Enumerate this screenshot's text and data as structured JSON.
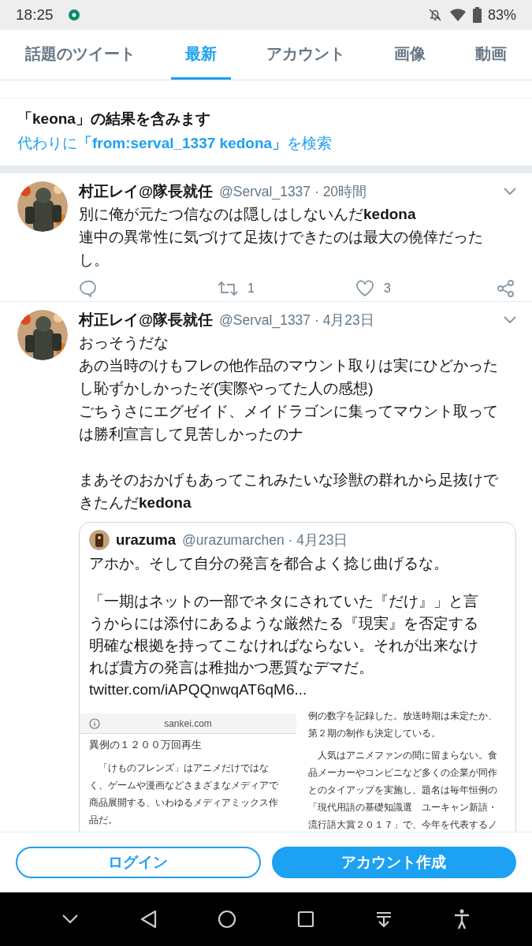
{
  "status_bar": {
    "time": "18:25",
    "battery": "83%"
  },
  "tabs": [
    {
      "label": "話題のツイート",
      "selected": false
    },
    {
      "label": "最新",
      "selected": true
    },
    {
      "label": "アカウント",
      "selected": false
    },
    {
      "label": "画像",
      "selected": false
    },
    {
      "label": "動画",
      "selected": false
    }
  ],
  "notice": {
    "title": "「keona」の結果を含みます",
    "suggestion": "代わりに**「from:serval_1337 kedona」**を検索"
  },
  "tweets": [
    {
      "name": "村正レイ@隊長就任",
      "meta": "@Serval_1337 · 20時間",
      "paragraphs": [
        [
          "別に俺が元たつ信なのは隠しはしないんだ**kedona**",
          "連中の異常性に気づけて足抜けできたのは最大の僥倖だった",
          "し。"
        ]
      ],
      "actions": {
        "retweets": "1",
        "likes": "3"
      }
    },
    {
      "name": "村正レイ@隊長就任",
      "meta": "@Serval_1337 · 4月23日",
      "paragraphs": [
        [
          "おっそうだな",
          "あの当時のけもフレの他作品のマウント取りは実にひどかった",
          "し恥ずかしかったぞ(実際やってた人の感想)",
          "ごちうさにエグゼイド、メイドラゴンに集ってマウント取って",
          "は勝利宣言して見苦しかったのナ"
        ],
        [
          "まあそのおかげもあってこれみたいな珍獣の群れから足抜けで",
          "きたんだ**kedona**"
        ]
      ],
      "quote": {
        "name": "urazuma",
        "meta": "@urazumarchen · 4月23日",
        "paragraphs": [
          [
            "アホか。そして自分の発言を都合よく捻じ曲げるな。"
          ],
          [
            "「一期はネットの一部でネタにされていた『だけ』」と言",
            "うからには添付にあるような厳然たる『現実』を否定する",
            "明確な根拠を持ってこなければならない。それが出来なけ",
            "れば貴方の発言は稚拙かつ悪質なデマだ。",
            "twitter.com/iAPQQnwqAT6qM6..."
          ]
        ],
        "media": [
          {
            "site": "sankei.com",
            "heading": "異例の１２００万回再生",
            "paragraphs": [
              [
                "　「けものフレンズ」はアニメだけではな",
                "く、ゲームや漫画などさまざまなメディアで",
                "商品展開する、いわゆるメディアミックス作",
                "品だ。"
              ]
            ]
          },
          {
            "paragraphs": [
              [
                "例の数字を記録した。放送時期は未定たか、",
                "第２期の制作も決定している。"
              ],
              [
                "　人気はアニメファンの間に留まらない。食",
                "品メーカーやコンビニなど多くの企業が同作",
                "とのタイアップを実施し、題名は毎年恒例の",
                "「現代用語の基礎知識選　ユーキャン新語・",
                "流行語大賞２０１７」で、今年を代表するノ"
              ]
            ]
          }
        ]
      }
    }
  ],
  "buttons": [
    {
      "kind": "outline",
      "label": "ログイン"
    },
    {
      "kind": "filled",
      "label": "アカウント作成"
    }
  ]
}
